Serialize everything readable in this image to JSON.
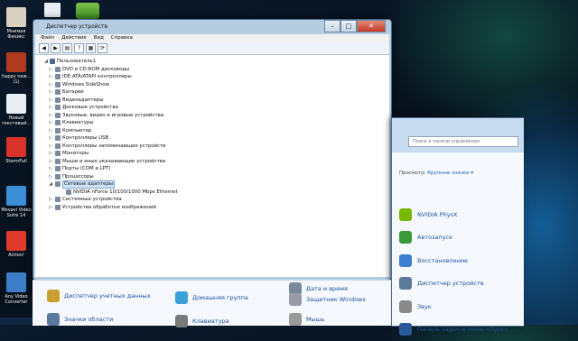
{
  "desktop": {
    "icons": [
      {
        "label": "Мнимая Физикс",
        "icon": "folder-icon",
        "color": "#d8d0c0"
      },
      {
        "label": "happy new... (1)",
        "icon": "file-icon",
        "color": "#b03a1f"
      },
      {
        "label": "Новый текстовый...",
        "icon": "text-file-icon",
        "color": "#e8eef4"
      },
      {
        "label": "StormFull",
        "icon": "app-icon",
        "color": "#d8332a"
      },
      {
        "label": "Movavi Video Suite 14",
        "icon": "movavi-icon",
        "color": "#3b8fd8"
      },
      {
        "label": "Action!",
        "icon": "record-icon",
        "color": "#e03a2a"
      },
      {
        "label": "Any Video Converter",
        "icon": "converter-icon",
        "color": "#3c7fc8"
      }
    ]
  },
  "device_manager": {
    "title": "Диспетчер устройств",
    "menu": [
      "Файл",
      "Действие",
      "Вид",
      "Справка"
    ],
    "toolbar_icons": [
      "back-arrow-icon",
      "forward-arrow-icon",
      "properties-icon",
      "help-icon",
      "view-icon",
      "scan-hardware-icon"
    ],
    "tree": {
      "root": "Пользователь1",
      "items": [
        {
          "label": "DVD и CD-ROM дисководы"
        },
        {
          "label": "IDE ATA/ATAPI контроллеры"
        },
        {
          "label": "Windows SideShow"
        },
        {
          "label": "Батареи"
        },
        {
          "label": "Видеоадаптеры"
        },
        {
          "label": "Дисковые устройства"
        },
        {
          "label": "Звуковые, видео и игровые устройства"
        },
        {
          "label": "Клавиатуры"
        },
        {
          "label": "Компьютер"
        },
        {
          "label": "Контроллеры USB"
        },
        {
          "label": "Контроллеры запоминающих устройств"
        },
        {
          "label": "Мониторы"
        },
        {
          "label": "Мыши и иные указывающие устройства"
        },
        {
          "label": "Порты (COM и LPT)"
        },
        {
          "label": "Процессоры"
        },
        {
          "label": "Сетевые адаптеры",
          "expanded": true,
          "selected": true
        },
        {
          "label": "NVIDIA nForce 10/100/1000 Mbps Ethernet",
          "child": true
        },
        {
          "label": "Системные устройства"
        },
        {
          "label": "Устройства обработки изображений"
        }
      ]
    }
  },
  "control_panel": {
    "search_placeholder": "Поиск в панели управления",
    "view_label": "Просмотр:",
    "view_value": "Крупные значки ▾",
    "items": [
      {
        "label": "NVIDIA PhysX",
        "icon": "nvidia-icon",
        "color": "#76b900"
      },
      {
        "label": "Автозапуск",
        "icon": "autoplay-icon",
        "color": "#3a9a3a"
      },
      {
        "label": "Восстановление",
        "icon": "recovery-icon",
        "color": "#3a7fd0"
      },
      {
        "label": "Диспетчер устройств",
        "icon": "device-manager-icon",
        "color": "#5a7a9a"
      },
      {
        "label": "Звук",
        "icon": "sound-icon",
        "color": "#8a8a8a"
      },
      {
        "label": "Панель задач и меню «Пуск»",
        "icon": "taskbar-icon",
        "color": "#2a5a9a"
      }
    ],
    "lower_items": [
      {
        "label": "Диспетчер учетных данных",
        "icon": "credentials-icon",
        "color": "#c8a030"
      },
      {
        "label": "Домашняя группа",
        "icon": "homegroup-icon",
        "color": "#3aa0d8"
      },
      {
        "label": "Дата и время",
        "icon": "clock-icon",
        "color": "#7a8a9a"
      },
      {
        "label": "Защитник Windows",
        "icon": "defender-icon",
        "color": "#9a9aa8"
      },
      {
        "label": "Значки области",
        "icon": "notification-icon",
        "color": "#5a7aa0"
      },
      {
        "label": "Клавиатура",
        "icon": "keyboard-icon",
        "color": "#7a7a7a"
      },
      {
        "label": "Мышь",
        "icon": "mouse-icon",
        "color": "#9a9a9a"
      }
    ]
  }
}
